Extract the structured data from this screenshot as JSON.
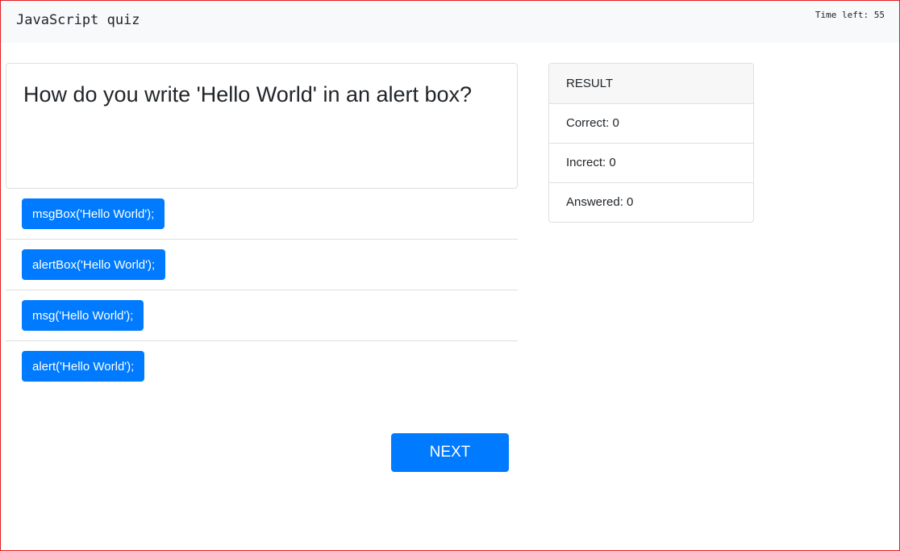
{
  "header": {
    "title": "JavaScript quiz",
    "timer": "Time left: 55"
  },
  "question": {
    "text": "How do you write 'Hello World' in an alert box?",
    "options": [
      "msgBox('Hello World');",
      "alertBox('Hello World');",
      "msg('Hello World');",
      "alert('Hello World');"
    ]
  },
  "next_button": {
    "label": "NEXT"
  },
  "result": {
    "title": "RESULT",
    "correct": "Correct: 0",
    "incorrect": "Increct: 0",
    "answered": "Answered: 0"
  },
  "colors": {
    "primary": "#007bff",
    "header_bg": "#f8f9fa",
    "border": "#dfdfdf",
    "frame": "#e31e24"
  }
}
